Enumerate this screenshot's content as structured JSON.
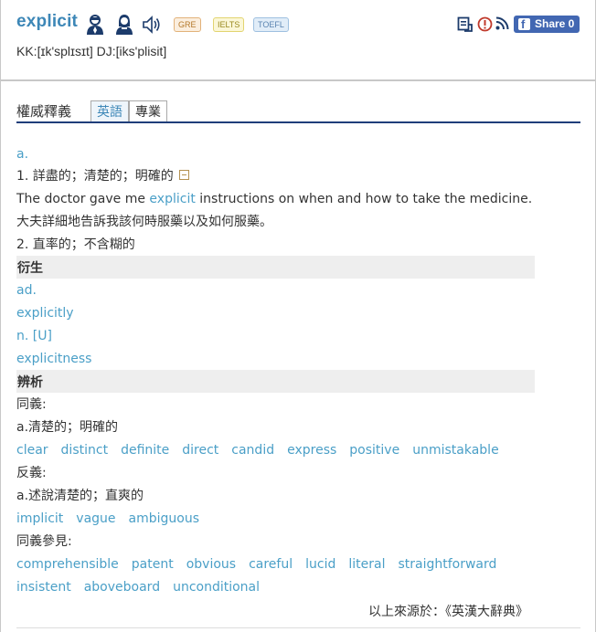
{
  "header": {
    "word": "explicit",
    "icons": [
      "male-speaker-icon",
      "female-speaker-icon",
      "speaker-icon"
    ],
    "badges": [
      "GRE",
      "IELTS",
      "TOEFL"
    ],
    "pronunciation": "KK:[ɪk'splɪsɪt] DJ:[iks'plisit]",
    "share_label": "Share 0",
    "tool_icons": [
      "vocabulary-icon",
      "report-icon",
      "rss-icon",
      "facebook-icon"
    ]
  },
  "section": {
    "title": "權威釋義",
    "tabs": [
      "英語",
      "專業"
    ]
  },
  "definitions": {
    "pos_adjective": "a.",
    "def1": "1. 詳盡的；清楚的；明確的",
    "example_pre": "The doctor gave me ",
    "example_word": "explicit",
    "example_post": " instructions on when and how to take the medicine.",
    "example_zh": "大夫詳細地告訴我該何時服藥以及如何服藥。",
    "def2": "2. 直率的；不含糊的"
  },
  "derived": {
    "heading": "衍生",
    "pos_adverb": "ad.",
    "adverb": "explicitly",
    "pos_noun": "n. [U]",
    "noun": "explicitness"
  },
  "distinction": {
    "heading": "辨析",
    "synonyms_label": "同義:",
    "synonyms_sense": "a.清楚的；明確的",
    "synonyms": [
      "clear",
      "distinct",
      "definite",
      "direct",
      "candid",
      "express",
      "positive",
      "unmistakable"
    ],
    "antonyms_label": "反義:",
    "antonyms_sense": "a.述說清楚的；直爽的",
    "antonyms": [
      "implicit",
      "vague",
      "ambiguous"
    ],
    "see_also_label": "同義參見:",
    "see_also_row1": [
      "comprehensible",
      "patent",
      "obvious",
      "careful",
      "lucid",
      "literal",
      "straightforward"
    ],
    "see_also_row2": [
      "insistent",
      "aboveboard",
      "unconditional"
    ]
  },
  "source": "以上來源於：《英漢大辭典》",
  "colors": {
    "accent": "#3d87b7",
    "link": "#4a9fc7",
    "rule": "#1f3e7a",
    "band": "#eeeeee"
  }
}
